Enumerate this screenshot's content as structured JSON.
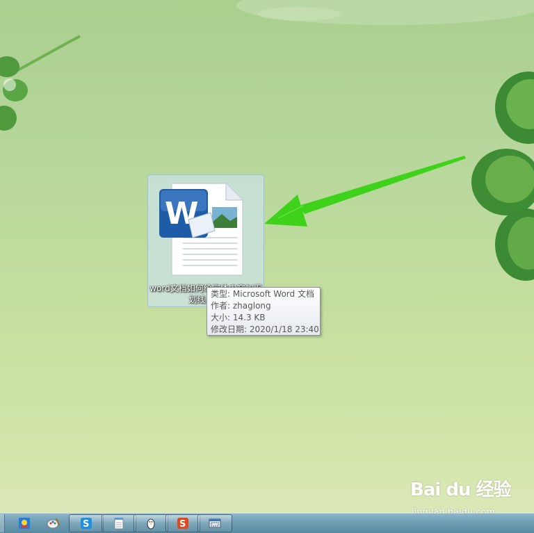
{
  "desktop": {
    "file": {
      "name": "word文档如何给字体内容加下划线.doc",
      "icon": "word-document-icon",
      "tooltip": {
        "type_line": "类型: Microsoft Word 文档",
        "author_line": "作者: zhaglong",
        "size_line": "大小: 14.3 KB",
        "modified_line": "修改日期: 2020/1/18 23:40"
      }
    },
    "annotation_arrow_color": "#3fd21a"
  },
  "watermark": {
    "logo_text": "Bai du 经验",
    "url": "jingyan.baidu.com"
  },
  "taskbar": {
    "buttons": [
      {
        "icon": "blue-app-icon"
      },
      {
        "icon": "paint-palette-icon"
      },
      {
        "icon": "sogou-s-icon"
      },
      {
        "icon": "notepad-icon"
      },
      {
        "icon": "qq-penguin-icon"
      },
      {
        "icon": "wps-s-icon"
      },
      {
        "icon": "window-capture-icon"
      }
    ]
  }
}
